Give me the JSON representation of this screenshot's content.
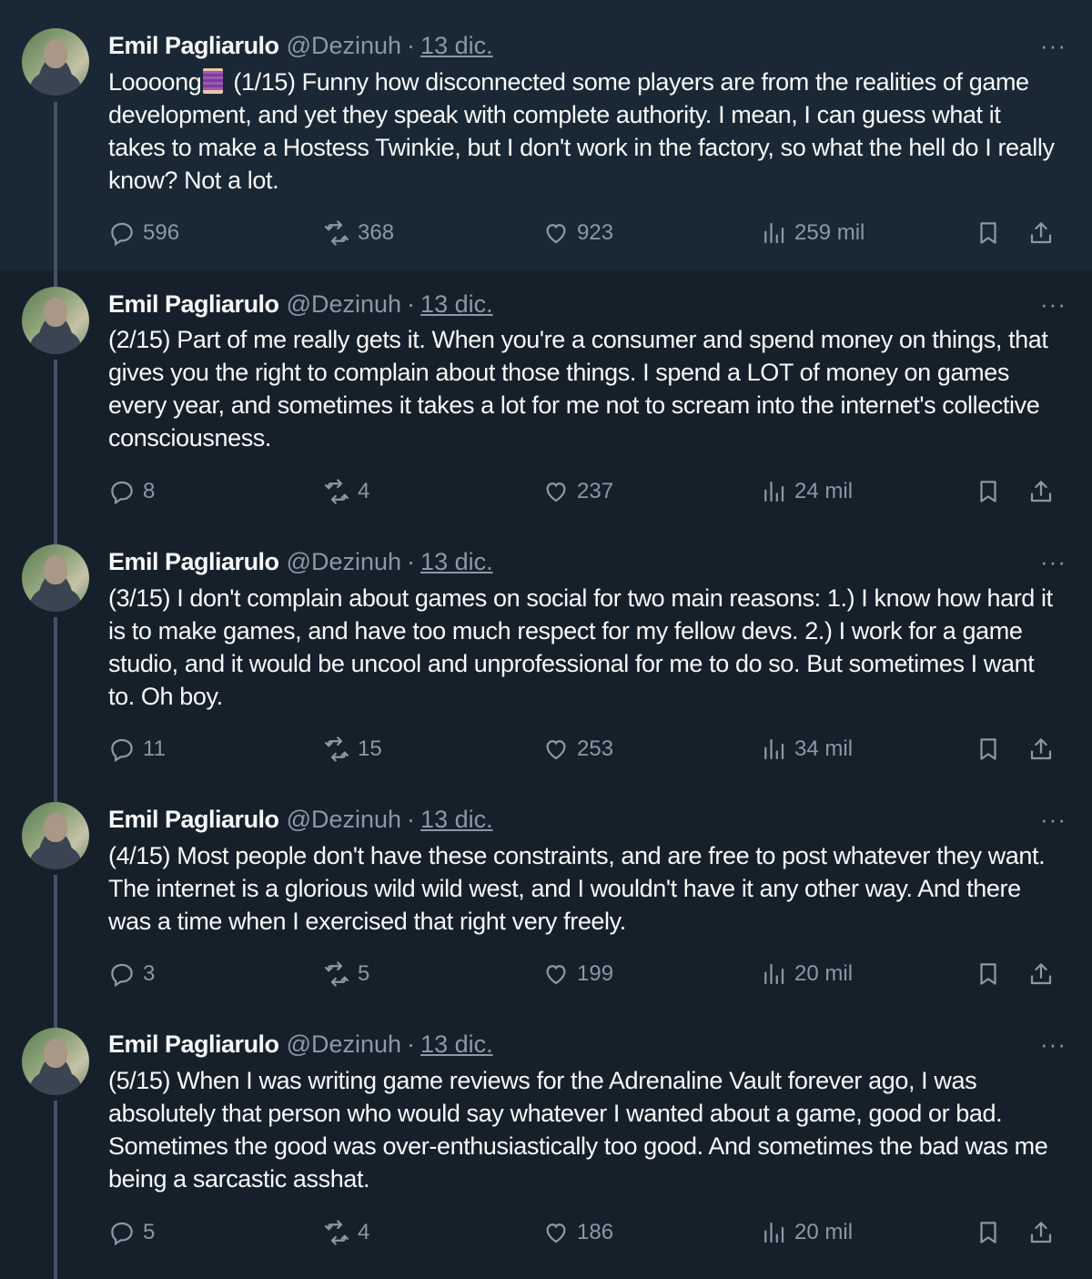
{
  "author": {
    "name": "Emil Pagliarulo",
    "handle": "@Dezinuh",
    "separator": "·"
  },
  "more_label": "···",
  "tweets": [
    {
      "date": "13 dic.",
      "text_before_emoji": "Loooong",
      "emoji": "thread-spool-emoji",
      "text": " (1/15) Funny how disconnected some players are from the realities of game development, and yet they speak with complete authority. I mean, I can guess what it takes to make a Hostess Twinkie, but I don't work in the factory, so what the hell do I really know? Not a lot.",
      "replies": "596",
      "reposts": "368",
      "likes": "923",
      "views": "259 mil"
    },
    {
      "date": "13 dic.",
      "text": "(2/15) Part of me really gets it. When you're a consumer and spend money on things, that gives you the right to complain about those things. I spend a LOT of money on games every year, and sometimes it takes a lot for me not to scream into the internet's collective consciousness.",
      "replies": "8",
      "reposts": "4",
      "likes": "237",
      "views": "24 mil"
    },
    {
      "date": "13 dic.",
      "text": "(3/15) I don't complain about games on social for two main reasons: 1.) I know how hard it is to make games, and have too much respect for my fellow devs. 2.) I work for a game studio, and it would be uncool and unprofessional for me to do so. But sometimes I want to. Oh boy.",
      "replies": "11",
      "reposts": "15",
      "likes": "253",
      "views": "34 mil"
    },
    {
      "date": "13 dic.",
      "text": "(4/15) Most people don't have these constraints, and are free to post whatever they want. The internet is a glorious wild wild west, and I wouldn't have it any other way. And there was a time when I exercised that right very freely.",
      "replies": "3",
      "reposts": "5",
      "likes": "199",
      "views": "20 mil"
    },
    {
      "date": "13 dic.",
      "text": "(5/15) When I was writing game reviews for the Adrenaline Vault forever ago, I was absolutely that person who would say whatever I wanted about a game, good or bad. Sometimes the good was over-enthusiastically too good. And sometimes the bad was me being a sarcastic asshat.",
      "replies": "5",
      "reposts": "4",
      "likes": "186",
      "views": "20 mil"
    }
  ],
  "icons": {
    "reply": "reply-icon",
    "repost": "repost-icon",
    "like": "heart-icon",
    "views": "views-chart-icon",
    "bookmark": "bookmark-icon",
    "share": "share-icon"
  },
  "colors": {
    "background": "#15202b",
    "first_tweet_background": "#1a2734",
    "text": "#f7f9f9",
    "muted": "#8b98a5",
    "thread_line": "#425364"
  }
}
